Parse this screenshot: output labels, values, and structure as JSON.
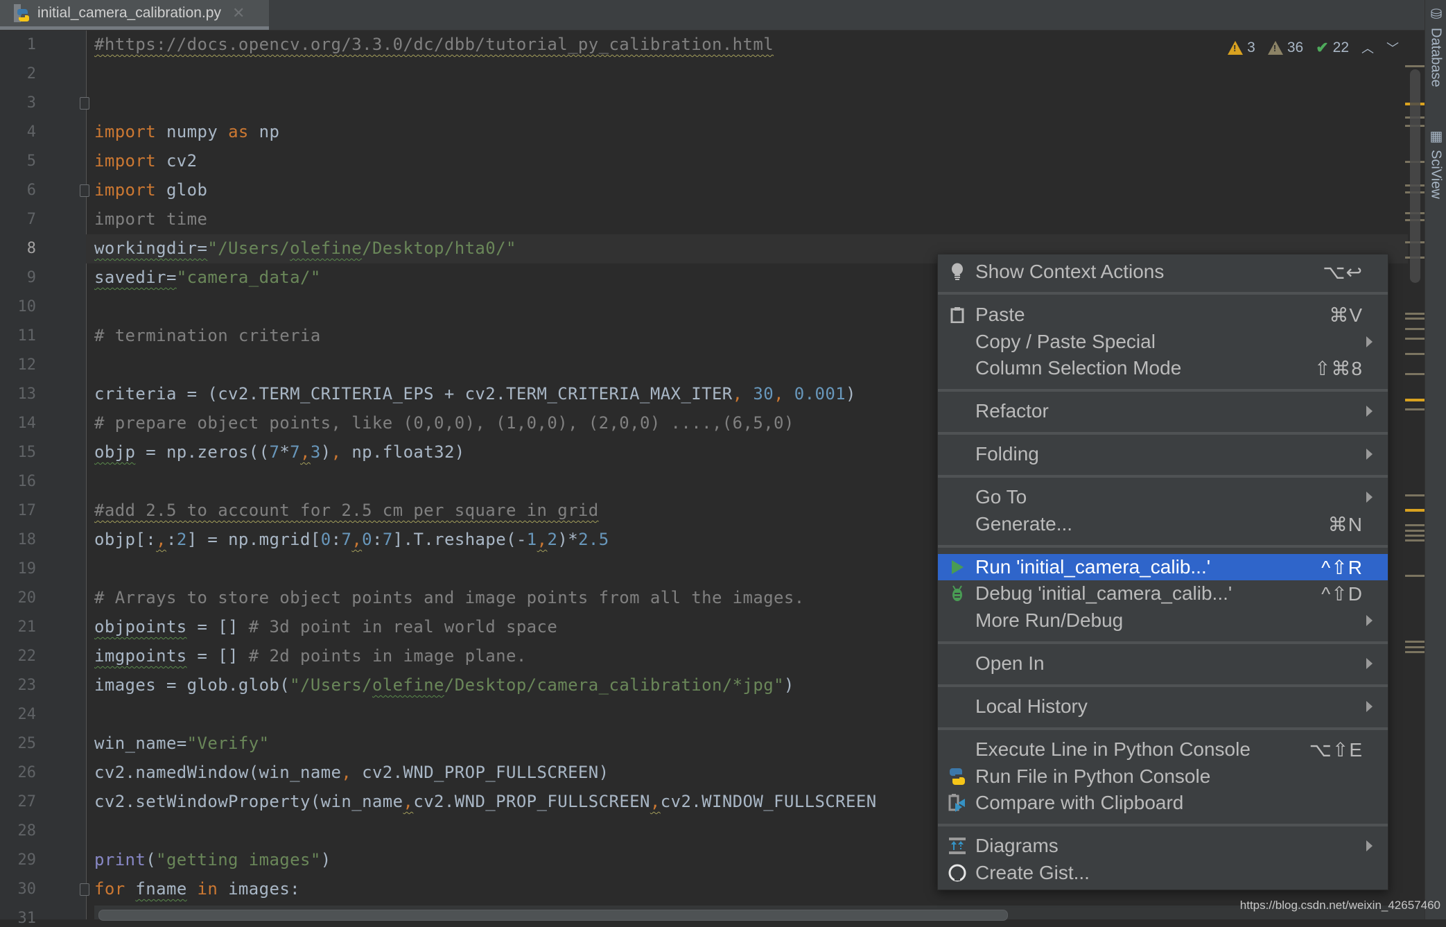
{
  "tab": {
    "filename": "initial_camera_calibration.py",
    "close_icon": "close-icon"
  },
  "inspections": {
    "warnings": "3",
    "weak_warnings": "36",
    "typos": "22"
  },
  "tool_windows": [
    "Database",
    "SciView"
  ],
  "editor": {
    "current_line": 8,
    "lines": [
      {
        "n": "1"
      },
      {
        "n": "2"
      },
      {
        "n": "3"
      },
      {
        "n": "4"
      },
      {
        "n": "5"
      },
      {
        "n": "6"
      },
      {
        "n": "7"
      },
      {
        "n": "8"
      },
      {
        "n": "9"
      },
      {
        "n": "10"
      },
      {
        "n": "11"
      },
      {
        "n": "12"
      },
      {
        "n": "13"
      },
      {
        "n": "14"
      },
      {
        "n": "15"
      },
      {
        "n": "16"
      },
      {
        "n": "17"
      },
      {
        "n": "18"
      },
      {
        "n": "19"
      },
      {
        "n": "20"
      },
      {
        "n": "21"
      },
      {
        "n": "22"
      },
      {
        "n": "23"
      },
      {
        "n": "24"
      },
      {
        "n": "25"
      },
      {
        "n": "26"
      },
      {
        "n": "27"
      },
      {
        "n": "28"
      },
      {
        "n": "29"
      },
      {
        "n": "30"
      },
      {
        "n": "31"
      }
    ],
    "code": {
      "l1": "#https://docs.opencv.org/3.3.0/dc/dbb/tutorial_py_calibration.html",
      "l3_kw": "import",
      "l3_mod": " numpy ",
      "l3_as": "as",
      "l3_alias": " np",
      "l4_kw": "import",
      "l4_mod": " cv2",
      "l5_kw": "import",
      "l5_mod": " glob",
      "l6": "import time",
      "l8_var": "workingdir=",
      "l8_str_a": "\"/Users/",
      "l8_str_u": "olefine",
      "l8_str_b": "/Desktop/hta0/\"",
      "l9_var": "savedir=",
      "l9_str": "\"camera_data/\"",
      "l11": "# termination criteria",
      "l13_a": "criteria = (cv2.TERM_CRITERIA_EPS + cv2.TERM_CRITERIA_MAX_ITER",
      "l13_c1": ",",
      "l13_n1": " 30",
      "l13_c2": ",",
      "l13_n2": " 0.001",
      "l13_end": ")",
      "l14": "# prepare object points, like (0,0,0), (1,0,0), (2,0,0) ....,(6,5,0)",
      "l15_var": "objp",
      "l15_a": " = np.zeros((",
      "l15_n1": "7",
      "l15_op": "*",
      "l15_n2": "7",
      "l15_c": ",",
      "l15_n3": "3",
      "l15_b": ")",
      "l15_c2": ",",
      "l15_e": " np.float32)",
      "l17": "#add 2.5 to account for 2.5 cm per square in grid",
      "l18_a": "objp[:",
      "l18_c": ",",
      "l18_b": ":",
      "l18_n1": "2",
      "l18_d": "] = np.mgrid[",
      "l18_n2": "0",
      "l18_e": ":",
      "l18_n3": "7",
      "l18_c2": ",",
      "l18_n4": "0",
      "l18_f": ":",
      "l18_n5": "7",
      "l18_g": "].T.reshape(-",
      "l18_n6": "1",
      "l18_c3": ",",
      "l18_n7": "2",
      "l18_h": ")*",
      "l18_n8": "2.5",
      "l20": "# Arrays to store object points and image points from all the images.",
      "l21_var": "objpoints",
      "l21_a": " = []",
      "l21_cmt": " # 3d point in real world space",
      "l22_var": "imgpoints",
      "l22_a": " = []",
      "l22_cmt": " # 2d points in image plane.",
      "l23_a": "images = glob.glob(",
      "l23_s1": "\"/Users/",
      "l23_su": "olefine",
      "l23_s2": "/Desktop/camera_calibration/*jpg\"",
      "l23_e": ")",
      "l25_var": "win_name=",
      "l25_str": "\"Verify\"",
      "l26_a": "cv2.namedWindow(win_name",
      "l26_c": ",",
      "l26_b": " cv2.WND_PROP_FULLSCREEN)",
      "l27_a": "cv2.setWindowProperty(win_name",
      "l27_c1": ",",
      "l27_b": "cv2.WND_PROP_FULLSCREEN",
      "l27_c2": ",",
      "l27_d": "cv2.WINDOW_FULLSCREEN",
      "l29_fn": "print",
      "l29_a": "(",
      "l29_str": "\"getting images\"",
      "l29_b": ")",
      "l30_kw": "for",
      "l30_var": "fname",
      "l30_in": "in",
      "l30_rest": " images:"
    }
  },
  "context_menu": {
    "items": [
      {
        "label": "Show Context Actions",
        "shortcut": "⌥↩",
        "icon": "lightbulb-icon"
      },
      {
        "label": "Paste",
        "shortcut": "⌘V",
        "icon": "clipboard-icon"
      },
      {
        "label": "Copy / Paste Special",
        "submenu": true
      },
      {
        "label": "Column Selection Mode",
        "shortcut": "⇧⌘8"
      },
      {
        "label": "Refactor",
        "submenu": true
      },
      {
        "label": "Folding",
        "submenu": true
      },
      {
        "label": "Go To",
        "submenu": true
      },
      {
        "label": "Generate...",
        "shortcut": "⌘N"
      },
      {
        "label": "Run 'initial_camera_calib...'",
        "shortcut": "^⇧R",
        "icon": "run-icon",
        "selected": true
      },
      {
        "label": "Debug 'initial_camera_calib...'",
        "shortcut": "^⇧D",
        "icon": "debug-bug-icon"
      },
      {
        "label": "More Run/Debug",
        "submenu": true
      },
      {
        "label": "Open In",
        "submenu": true
      },
      {
        "label": "Local History",
        "submenu": true
      },
      {
        "label": "Execute Line in Python Console",
        "shortcut": "⌥⇧E"
      },
      {
        "label": "Run File in Python Console",
        "icon": "python-icon"
      },
      {
        "label": "Compare with Clipboard",
        "icon": "compare-clipboard-icon"
      },
      {
        "label": "Diagrams",
        "submenu": true,
        "icon": "diagrams-icon"
      },
      {
        "label": "Create Gist...",
        "icon": "github-icon"
      }
    ]
  },
  "watermark": "https://blog.csdn.net/weixin_42657460",
  "colors": {
    "selection": "#2f65ca",
    "keyword": "#cc7832",
    "string": "#6a8759",
    "number": "#6897bb",
    "comment": "#808080",
    "warning": "#d9a220"
  }
}
